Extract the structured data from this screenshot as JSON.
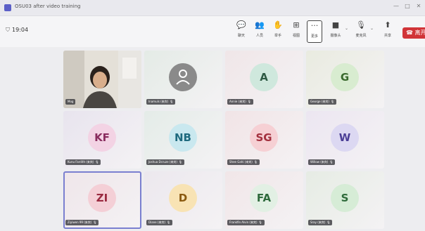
{
  "window": {
    "title": "OSU03 after video training",
    "icon": "teams-logo-icon",
    "controls": [
      "—",
      "□",
      "✕"
    ]
  },
  "meeting": {
    "elapsed_time": "19:04"
  },
  "toolbar": {
    "buttons": [
      {
        "icon": "chat-icon",
        "glyph": "💬",
        "label": "聊天"
      },
      {
        "icon": "people-icon",
        "glyph": "👥",
        "label": "人员"
      },
      {
        "icon": "raise-hand-icon",
        "glyph": "✋",
        "label": "举手"
      },
      {
        "icon": "view-icon",
        "glyph": "⊞",
        "label": "视图"
      },
      {
        "icon": "more-icon",
        "glyph": "···",
        "label": "更多"
      },
      {
        "icon": "camera-icon",
        "glyph": "■",
        "label": "摄像头"
      },
      {
        "icon": "mic-icon",
        "glyph": "🎙",
        "label": "麦克风"
      },
      {
        "icon": "share-icon",
        "glyph": "⬆",
        "label": "共享"
      }
    ],
    "leave_label": "离开",
    "leave_color": "#d13438"
  },
  "participants": [
    {
      "name": "Mog",
      "type": "video"
    },
    {
      "name": "Inamuls (来宾)",
      "initials": "",
      "icon": "person-icon",
      "bg": "#8a8a8a",
      "fg": "#ffffff",
      "tile": "#e4ebe6"
    },
    {
      "name": "Annie (来宾)",
      "initials": "A",
      "bg": "#cfe8dd",
      "fg": "#2e5a44",
      "tile": "#f0e6e8"
    },
    {
      "name": "George (来宾)",
      "initials": "G",
      "bg": "#d8ecd0",
      "fg": "#3a6a2e",
      "tile": "#e9ebe0"
    },
    {
      "name": "Kunu Fardith (来宾)",
      "initials": "KF",
      "bg": "#f3d3e4",
      "fg": "#8a2c5e",
      "tile": "#e8e4ee"
    },
    {
      "name": "Joshua Dcruze (来宾)",
      "initials": "NB",
      "bg": "#c9e8ef",
      "fg": "#1e6a7e",
      "tile": "#e4ece8"
    },
    {
      "name": "Shee Gahi (来宾)",
      "initials": "SG",
      "bg": "#f6d0d4",
      "fg": "#a3303e",
      "tile": "#f1e4e6"
    },
    {
      "name": "Willow (来宾)",
      "initials": "W",
      "bg": "#dcd8f2",
      "fg": "#4b3f96",
      "tile": "#ece6f1"
    },
    {
      "name": "Ziyiwen 99 (来宾)",
      "initials": "ZI",
      "bg": "#f4cfd6",
      "fg": "#9a2a40",
      "tile": "#efe6ea",
      "active": true
    },
    {
      "name": "Diane (来宾)",
      "initials": "D",
      "bg": "#f8e3b4",
      "fg": "#8a5a10",
      "tile": "#ece8ee"
    },
    {
      "name": "Frankfin Alvin (来宾)",
      "initials": "FA",
      "bg": "#e2f0e4",
      "fg": "#2e6a3c",
      "tile": "#f1e6e8"
    },
    {
      "name": "Sray (来宾)",
      "initials": "S",
      "bg": "#d6ecd6",
      "fg": "#2e6a3a",
      "tile": "#e6ece4"
    }
  ]
}
